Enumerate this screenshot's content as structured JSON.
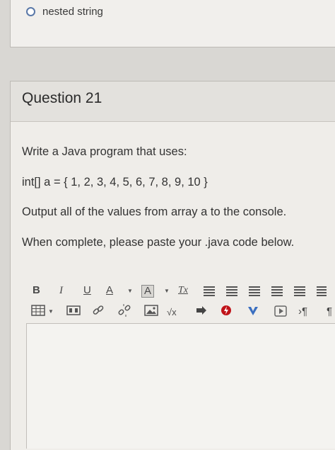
{
  "previous_question": {
    "option_label": "nested string"
  },
  "question": {
    "title": "Question 21",
    "lines": [
      "Write a Java program that uses:",
      "int[] a = { 1, 2, 3, 4, 5, 6, 7, 8, 9, 10 }",
      "Output all of the values from array a to the console.",
      "When complete, please paste your .java code below."
    ]
  },
  "toolbar": {
    "bold": "B",
    "italic": "I",
    "underline": "U",
    "font_color": "A",
    "highlight_color": "A",
    "clear_format": "Tx",
    "sqrt": "√x",
    "paragraph": "¶"
  },
  "colors": {
    "radio_border": "#5a78a8",
    "red_icon": "#c0141a",
    "blue_icon": "#3b6fc0"
  }
}
